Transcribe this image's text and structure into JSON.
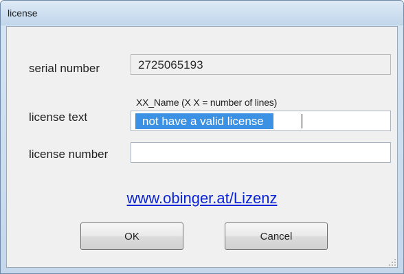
{
  "window": {
    "title": "license"
  },
  "fields": {
    "serial_label": "serial number",
    "serial_value": "2725065193",
    "license_text_label": "license text",
    "license_text_hint": "XX_Name (X X = number of lines)",
    "license_text_value": "not have a valid license",
    "license_number_label": "license number",
    "license_number_value": ""
  },
  "link": {
    "text": "www.obinger.at/Lizenz"
  },
  "buttons": {
    "ok": "OK",
    "cancel": "Cancel"
  },
  "colors": {
    "link": "#0a24d6",
    "selection": "#3b91e4"
  }
}
